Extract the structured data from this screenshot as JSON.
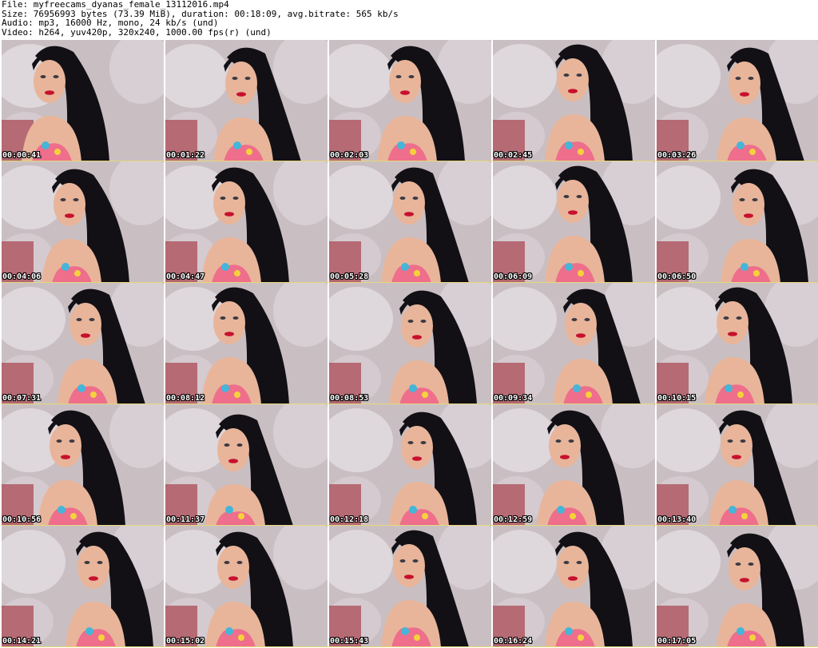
{
  "header": {
    "line1": "File: myfreecams_dyanas_female_13112016.mp4",
    "line2": "Size: 76956993 bytes (73.39 MiB), duration: 00:18:09, avg.bitrate: 565 kb/s",
    "line3": "Audio: mp3, 16000 Hz, mono, 24 kb/s (und)",
    "line4": "Video: h264, yuv420p, 320x240, 1000.00 fps(r) (und)"
  },
  "thumbnails": [
    {
      "time": "00:00:41"
    },
    {
      "time": "00:01:22"
    },
    {
      "time": "00:02:03"
    },
    {
      "time": "00:02:45"
    },
    {
      "time": "00:03:26"
    },
    {
      "time": "00:04:06"
    },
    {
      "time": "00:04:47"
    },
    {
      "time": "00:05:28"
    },
    {
      "time": "00:06:09"
    },
    {
      "time": "00:06:50"
    },
    {
      "time": "00:07:31"
    },
    {
      "time": "00:08:12"
    },
    {
      "time": "00:08:53"
    },
    {
      "time": "00:09:34"
    },
    {
      "time": "00:10:15"
    },
    {
      "time": "00:10:56"
    },
    {
      "time": "00:11:37"
    },
    {
      "time": "00:12:18"
    },
    {
      "time": "00:12:59"
    },
    {
      "time": "00:13:40"
    },
    {
      "time": "00:14:21"
    },
    {
      "time": "00:15:02"
    },
    {
      "time": "00:15:43"
    },
    {
      "time": "00:16:24"
    },
    {
      "time": "00:17:05"
    }
  ],
  "colors": {
    "background_wall": "#c9bfc3",
    "skin": "#e8b59a",
    "hair": "#121015",
    "top": "#ee6e8c",
    "lips": "#c8102e",
    "timestamp_separator": "#e6d87a"
  }
}
